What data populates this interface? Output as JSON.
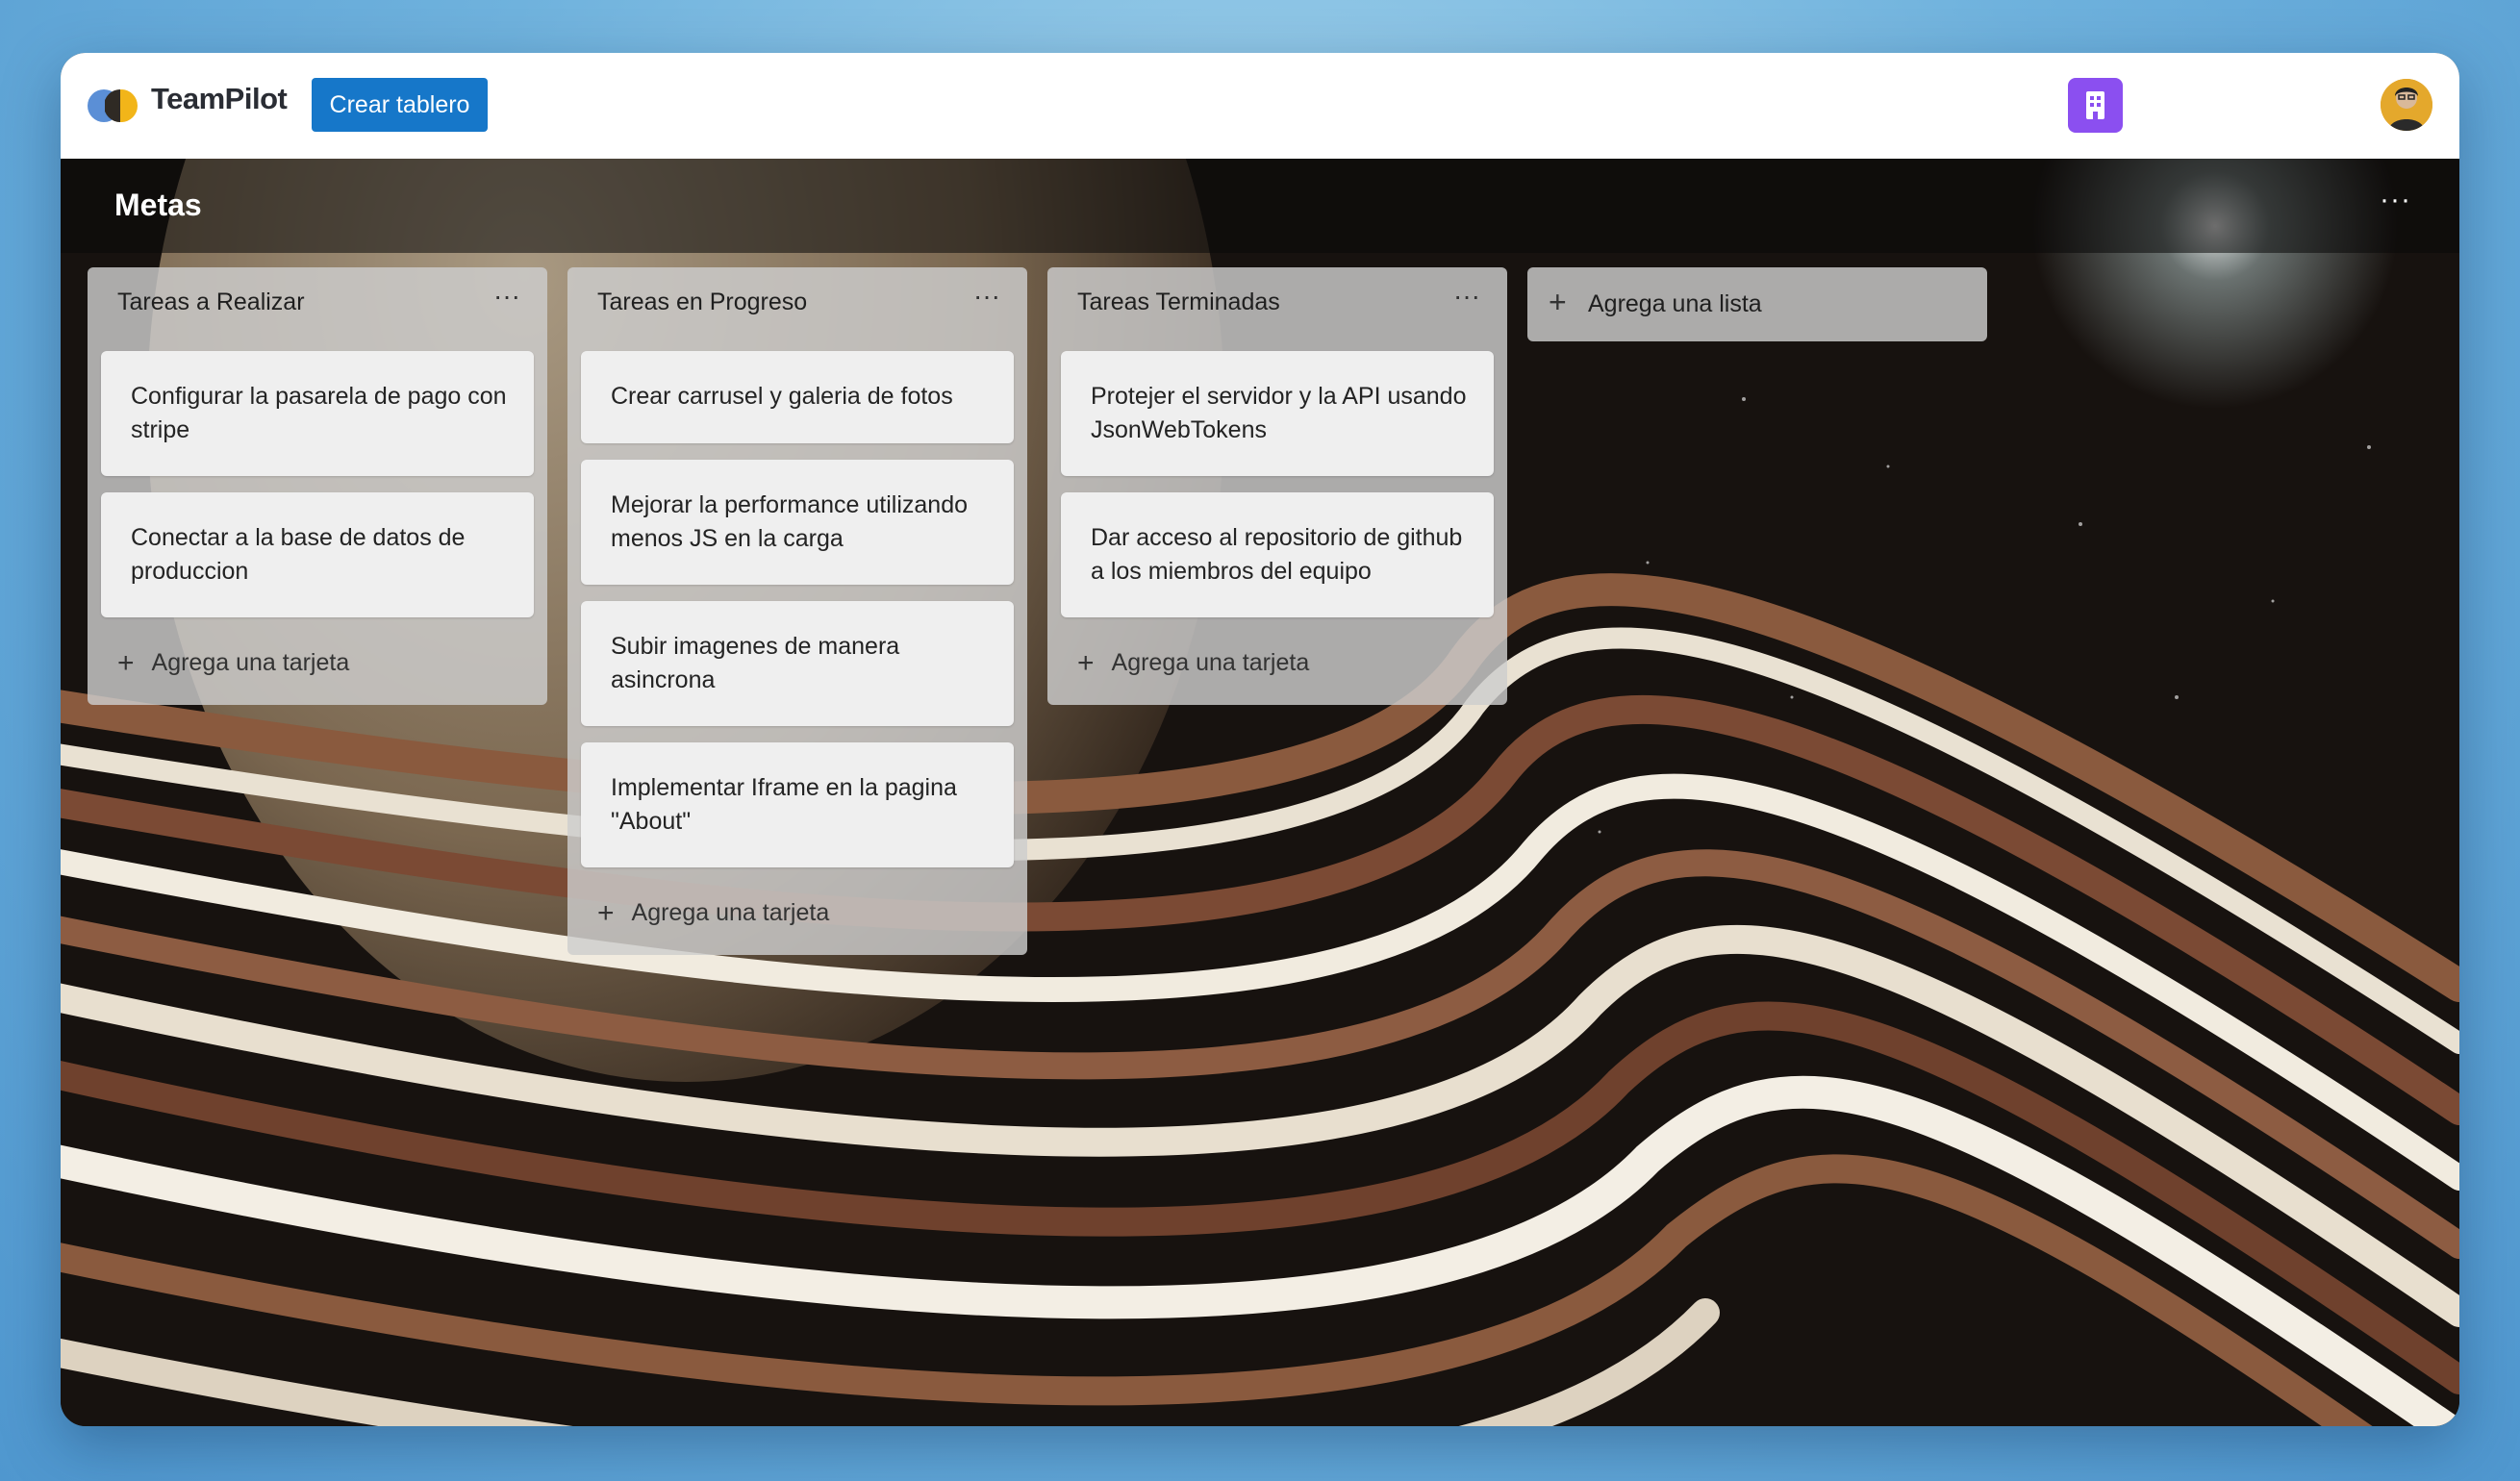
{
  "app": {
    "name": "TeamPilot",
    "create_board_label": "Crear tablero",
    "org_icon": "building-icon",
    "avatar": "user-avatar"
  },
  "board": {
    "title": "Metas",
    "menu_label": "···"
  },
  "colors": {
    "primary_button": "#1677c9",
    "org_badge": "#8b4ff0",
    "avatar_bg": "#e4a82c"
  },
  "lists": [
    {
      "title": "Tareas a Realizar",
      "menu": "···",
      "cards": [
        "Configurar la pasarela de pago con stripe",
        "Conectar a la base de datos de produccion"
      ],
      "add_card_label": "Agrega una tarjeta"
    },
    {
      "title": "Tareas en Progreso",
      "menu": "···",
      "cards": [
        "Crear carrusel y galeria de fotos",
        "Mejorar la performance utilizando menos JS en la carga",
        "Subir imagenes de manera asincrona",
        "Implementar Iframe en la pagina \"About\""
      ],
      "add_card_label": "Agrega una tarjeta"
    },
    {
      "title": "Tareas Terminadas",
      "menu": "···",
      "cards": [
        "Protejer el servidor y la API usando JsonWebTokens",
        "Dar acceso al repositorio de github a los miembros del equipo"
      ],
      "add_card_label": "Agrega una tarjeta"
    }
  ],
  "add_list_label": "Agrega una lista"
}
